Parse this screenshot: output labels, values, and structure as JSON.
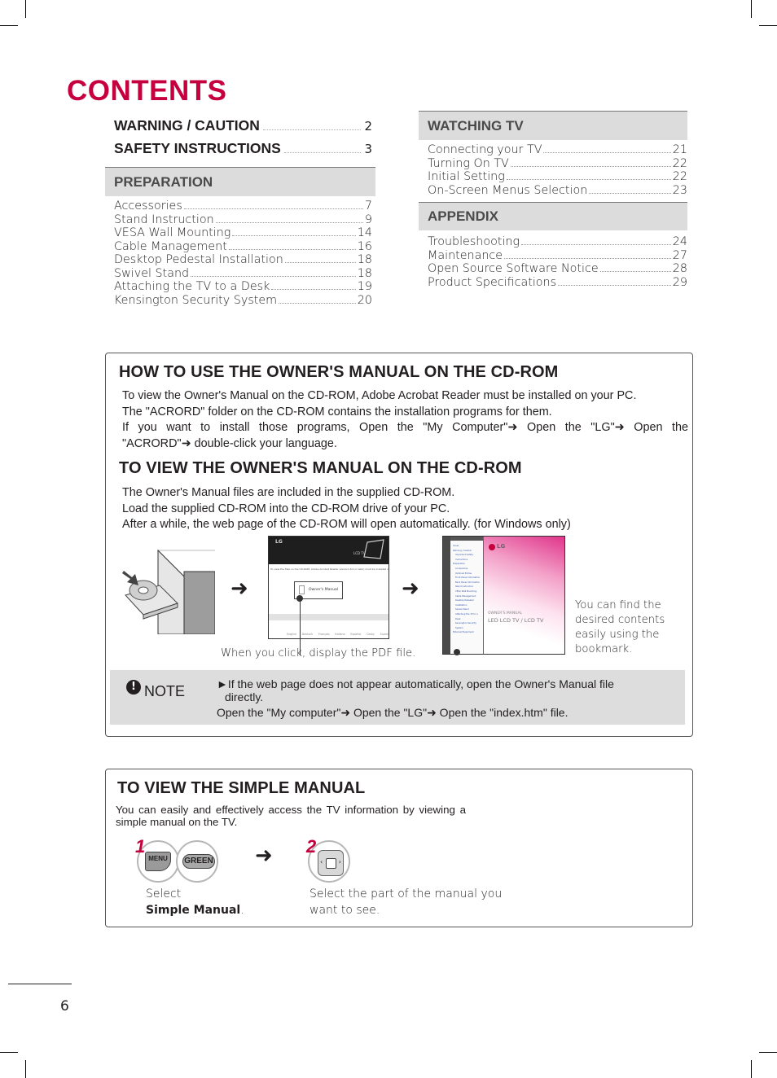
{
  "page": {
    "title": "CONTENTS",
    "page_number": "6"
  },
  "toc": {
    "major": [
      {
        "label": "WARNING / CAUTION",
        "page": "2"
      },
      {
        "label": "SAFETY INSTRUCTIONS",
        "page": "3"
      }
    ],
    "sections": [
      {
        "title": "PREPARATION",
        "items": [
          {
            "label": "Accessories",
            "page": "7"
          },
          {
            "label": "Stand Instruction",
            "page": "9"
          },
          {
            "label": "VESA Wall Mounting",
            "page": "14"
          },
          {
            "label": "Cable Management",
            "page": "16"
          },
          {
            "label": "Desktop Pedestal Installation",
            "page": "18"
          },
          {
            "label": "Swivel Stand",
            "page": "18"
          },
          {
            "label": "Attaching the TV to a Desk",
            "page": "19"
          },
          {
            "label": "Kensington Security System",
            "page": "20"
          }
        ]
      },
      {
        "title": "WATCHING TV",
        "items": [
          {
            "label": "Connecting your TV",
            "page": "21"
          },
          {
            "label": "Turning On TV",
            "page": "22"
          },
          {
            "label": "Initial Setting",
            "page": "22"
          },
          {
            "label": "On-Screen Menus Selection",
            "page": "23"
          }
        ]
      },
      {
        "title": "APPENDIX",
        "items": [
          {
            "label": "Troubleshooting",
            "page": "24"
          },
          {
            "label": "Maintenance",
            "page": "27"
          },
          {
            "label": "Open Source Software Notice",
            "page": "28"
          },
          {
            "label": "Product Specifications",
            "page": "29"
          }
        ]
      }
    ]
  },
  "cdrom": {
    "howto_heading": "HOW TO USE THE OWNER'S MANUAL ON THE CD-ROM",
    "howto_lines": [
      "To view the Owner's Manual on the CD-ROM, Adobe Acrobat Reader must be installed on your PC.",
      "The \"ACRORD\" folder on the CD-ROM contains the installation programs for them.",
      "If you want to install those programs, Open the \"My Computer\"➜ Open the \"LG\"➜ Open the",
      "\"ACRORD\"➜ double-click your language."
    ],
    "view_heading": "TO VIEW THE OWNER'S MANUAL ON THE CD-ROM",
    "view_lines": [
      "The Owner's Manual files are included in the supplied CD-ROM.",
      "Load the supplied CD-ROM into the CD-ROM drive of your PC.",
      "After a while, the web page of the CD-ROM will open automatically. (for Windows only)"
    ],
    "arrow": "➜",
    "caption_click": "When you click, display the PDF file.",
    "caption_bookmark": "You can find the desired contents easily using the bookmark.",
    "screenshot_web": {
      "brand": "LG",
      "product_tag": "LCD TV",
      "notice": "To view the files on the CD-ROM, Adobe Acrobat Reader (version 8.0 or later) must be installed on your computer.",
      "owners_manual_button": "Owner's Manual",
      "languages": [
        "English",
        "Deutsch",
        "Français",
        "Italiano",
        "Español",
        "Česky",
        "Suomi"
      ]
    },
    "screenshot_pdf": {
      "brand": "LG",
      "doc_type": "OWNER'S MANUAL",
      "doc_title": "LED LCD TV / LCD TV",
      "bookmarks": [
        "Cover",
        "Warning / Caution",
        "Important Safety Instructions",
        "Preparation",
        "Accessories",
        "Optional Extras",
        "Front Panel Information",
        "Back Panel Information",
        "Stand Instruction",
        "VESA Wall Mounting",
        "Cable Management",
        "Desktop Pedestal Installation",
        "Swivel Stand",
        "Attaching the TV to a Desk",
        "Kensington Security System",
        "External Equipment"
      ]
    },
    "note": {
      "label": "NOTE",
      "icon": "exclamation-icon",
      "line1": "►If the web page does not appear automatically, open the Owner's Manual file",
      "line1b": "directly.",
      "line2": "Open the \"My computer\"➜ Open the \"LG\"➜ Open the \"index.htm\" file."
    }
  },
  "simple_manual": {
    "heading": "TO VIEW THE SIMPLE MANUAL",
    "intro": "You can easily and effectively access the TV information by viewing a simple manual on the TV.",
    "step1": {
      "number": "1",
      "buttons": [
        "MENU",
        "GREEN"
      ],
      "caption_prefix": "Select",
      "caption_bold": "Simple Manual",
      "caption_suffix": "."
    },
    "arrow": "➜",
    "step2": {
      "number": "2",
      "caption": "Select the part of the manual you want to see."
    }
  },
  "colors": {
    "brand_magenta": "#c6003f",
    "section_header_bg": "#dcdcdc",
    "note_bg": "#dddddd"
  }
}
